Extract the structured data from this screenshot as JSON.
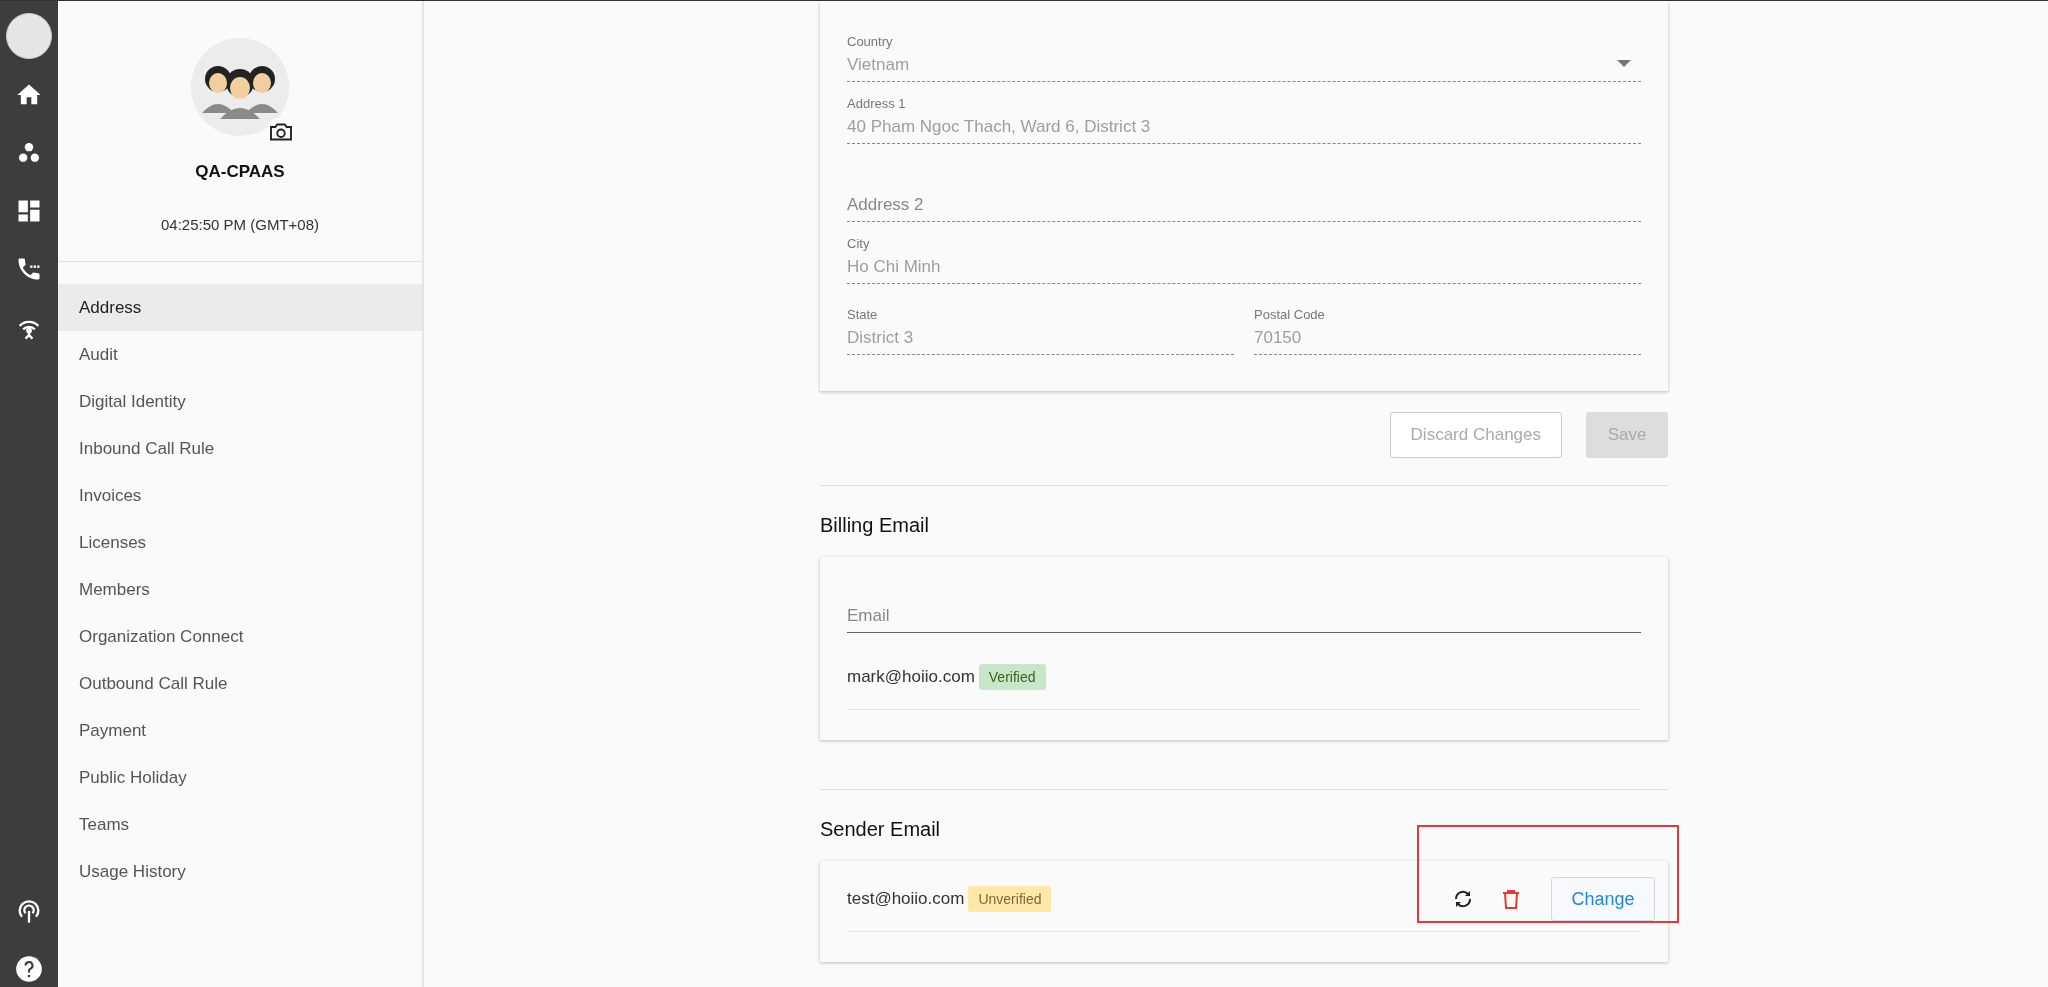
{
  "profile": {
    "name": "QA-CPAAS",
    "time": "04:25:50 PM (GMT+08)"
  },
  "sidebar": {
    "items": [
      {
        "label": "Address",
        "selected": true
      },
      {
        "label": "Audit",
        "selected": false
      },
      {
        "label": "Digital Identity",
        "selected": false
      },
      {
        "label": "Inbound Call Rule",
        "selected": false
      },
      {
        "label": "Invoices",
        "selected": false
      },
      {
        "label": "Licenses",
        "selected": false
      },
      {
        "label": "Members",
        "selected": false
      },
      {
        "label": "Organization Connect",
        "selected": false
      },
      {
        "label": "Outbound Call Rule",
        "selected": false
      },
      {
        "label": "Payment",
        "selected": false
      },
      {
        "label": "Public Holiday",
        "selected": false
      },
      {
        "label": "Teams",
        "selected": false
      },
      {
        "label": "Usage History",
        "selected": false
      }
    ]
  },
  "address_form": {
    "fields": [
      {
        "kind": "select",
        "label": "Country",
        "value": "Vietnam"
      },
      {
        "kind": "text",
        "label": "Address 1",
        "value": "40 Pham Ngoc Thach, Ward 6, District 3"
      },
      {
        "kind": "empty",
        "placeholder": "Address 2"
      },
      {
        "kind": "text",
        "label": "City",
        "value": "Ho Chi Minh"
      },
      {
        "kind": "text",
        "label": "State",
        "value": "District 3"
      },
      {
        "kind": "text",
        "label": "Postal Code",
        "value": "70150"
      }
    ],
    "buttons": [
      {
        "kind": "outline",
        "label": "Discard Changes",
        "disabled": true
      },
      {
        "kind": "filled",
        "label": "Save",
        "disabled": true
      }
    ]
  },
  "billing_email": {
    "title": "Billing Email",
    "placeholder": "Email",
    "emails": [
      {
        "address": "mark@hoiio.com",
        "status": "Verified",
        "kind": "verified"
      }
    ]
  },
  "sender_email": {
    "title": "Sender Email",
    "emails": [
      {
        "address": "test@hoiio.com",
        "status": "Unverified",
        "kind": "unverified",
        "action": "Change"
      }
    ]
  }
}
